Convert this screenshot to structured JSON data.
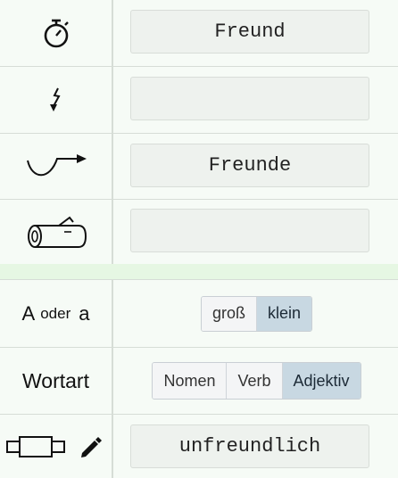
{
  "rows": {
    "singular": {
      "icon": "stopwatch-icon",
      "value": "Freund"
    },
    "umlaut": {
      "icon": "lightning-arrow-icon",
      "value": ""
    },
    "plural": {
      "icon": "curved-arrow-icon",
      "value": "Freunde"
    },
    "stem": {
      "icon": "log-icon",
      "value": ""
    }
  },
  "case": {
    "label_upper": "A",
    "label_oder": "oder",
    "label_lower": "a",
    "options": [
      "groß",
      "klein"
    ],
    "selected": "klein"
  },
  "wordtype": {
    "label": "Wortart",
    "options": [
      "Nomen",
      "Verb",
      "Adjektiv"
    ],
    "selected": "Adjektiv"
  },
  "edit": {
    "icons": [
      "component-icon",
      "pencil-icon"
    ],
    "value": "unfreundlich"
  },
  "colors": {
    "background": "#f6fbf6",
    "separator": "#e6f7e3",
    "selected_option": "#c8d8e2"
  }
}
